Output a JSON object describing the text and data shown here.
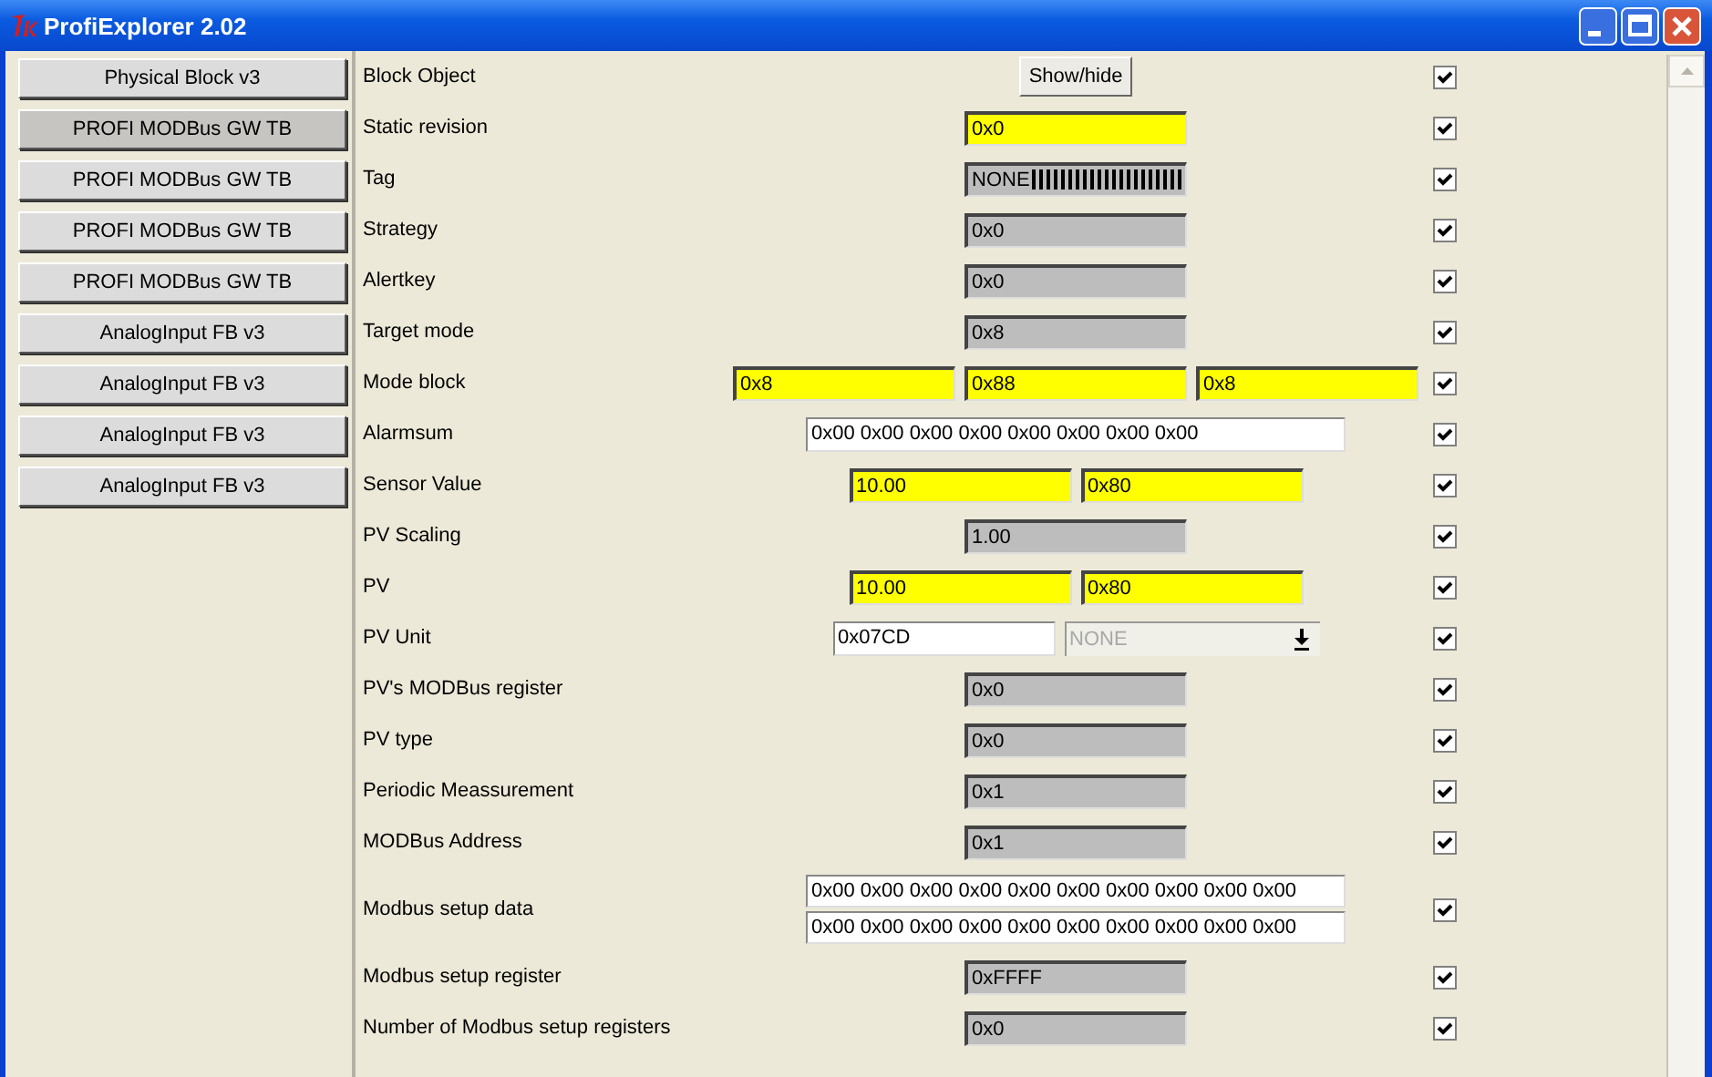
{
  "window": {
    "title": "ProfiExplorer 2.02"
  },
  "blocks": [
    {
      "label": "Physical Block v3",
      "selected": false
    },
    {
      "label": "PROFI MODBus GW TB",
      "selected": true
    },
    {
      "label": "PROFI MODBus GW TB",
      "selected": false
    },
    {
      "label": "PROFI MODBus GW TB",
      "selected": false
    },
    {
      "label": "PROFI MODBus GW TB",
      "selected": false
    },
    {
      "label": "AnalogInput FB v3",
      "selected": false
    },
    {
      "label": "AnalogInput FB v3",
      "selected": false
    },
    {
      "label": "AnalogInput FB v3",
      "selected": false
    },
    {
      "label": "AnalogInput FB v3",
      "selected": false
    }
  ],
  "parameters": [
    {
      "label": "Block Object",
      "checked": true,
      "controls": [
        {
          "kind": "button",
          "value": "Show/hide"
        }
      ]
    },
    {
      "label": "Static revision",
      "checked": true,
      "controls": [
        {
          "kind": "editable",
          "value": "0x0"
        }
      ]
    },
    {
      "label": "Tag",
      "checked": true,
      "controls": [
        {
          "kind": "readonly",
          "value": "NONE",
          "garbled_tail": true
        }
      ]
    },
    {
      "label": "Strategy",
      "checked": true,
      "controls": [
        {
          "kind": "readonly",
          "value": "0x0"
        }
      ]
    },
    {
      "label": "Alertkey",
      "checked": true,
      "controls": [
        {
          "kind": "readonly",
          "value": "0x0"
        }
      ]
    },
    {
      "label": "Target mode",
      "checked": true,
      "controls": [
        {
          "kind": "readonly",
          "value": "0x8"
        }
      ]
    },
    {
      "label": "Mode block",
      "checked": true,
      "controls": [
        {
          "kind": "editable",
          "value": "0x8"
        },
        {
          "kind": "editable",
          "value": "0x88"
        },
        {
          "kind": "editable",
          "value": "0x8"
        }
      ]
    },
    {
      "label": "Alarmsum",
      "checked": true,
      "controls": [
        {
          "kind": "wide",
          "value": "0x00 0x00 0x00 0x00 0x00 0x00 0x00 0x00"
        }
      ]
    },
    {
      "label": "Sensor Value",
      "checked": true,
      "controls": [
        {
          "kind": "editable",
          "value": "10.00"
        },
        {
          "kind": "editable",
          "value": "0x80"
        }
      ]
    },
    {
      "label": "PV Scaling",
      "checked": true,
      "controls": [
        {
          "kind": "readonly",
          "value": "1.00"
        }
      ]
    },
    {
      "label": "PV",
      "checked": true,
      "controls": [
        {
          "kind": "editable",
          "value": "10.00"
        },
        {
          "kind": "editable",
          "value": "0x80"
        }
      ]
    },
    {
      "label": "PV Unit",
      "checked": true,
      "controls": [
        {
          "kind": "input",
          "value": "0x07CD"
        },
        {
          "kind": "combo",
          "value": "NONE",
          "disabled": true
        }
      ]
    },
    {
      "label": "PV's MODBus register",
      "checked": true,
      "controls": [
        {
          "kind": "readonly",
          "value": "0x0"
        }
      ]
    },
    {
      "label": "PV type",
      "checked": true,
      "controls": [
        {
          "kind": "readonly",
          "value": "0x0"
        }
      ]
    },
    {
      "label": "Periodic Meassurement",
      "checked": true,
      "controls": [
        {
          "kind": "readonly",
          "value": "0x1"
        }
      ]
    },
    {
      "label": "MODBus Address",
      "checked": true,
      "controls": [
        {
          "kind": "readonly",
          "value": "0x1"
        }
      ]
    },
    {
      "label": "Modbus setup data",
      "checked": true,
      "stacked": true,
      "controls": [
        {
          "kind": "wide",
          "value": "0x00 0x00 0x00 0x00 0x00 0x00 0x00 0x00 0x00 0x00"
        },
        {
          "kind": "wide",
          "value": "0x00 0x00 0x00 0x00 0x00 0x00 0x00 0x00 0x00 0x00"
        }
      ]
    },
    {
      "label": "Modbus setup register",
      "checked": true,
      "controls": [
        {
          "kind": "readonly",
          "value": "0xFFFF"
        }
      ]
    },
    {
      "label": "Number of Modbus setup registers",
      "checked": true,
      "controls": [
        {
          "kind": "readonly",
          "value": "0x0"
        }
      ]
    }
  ]
}
